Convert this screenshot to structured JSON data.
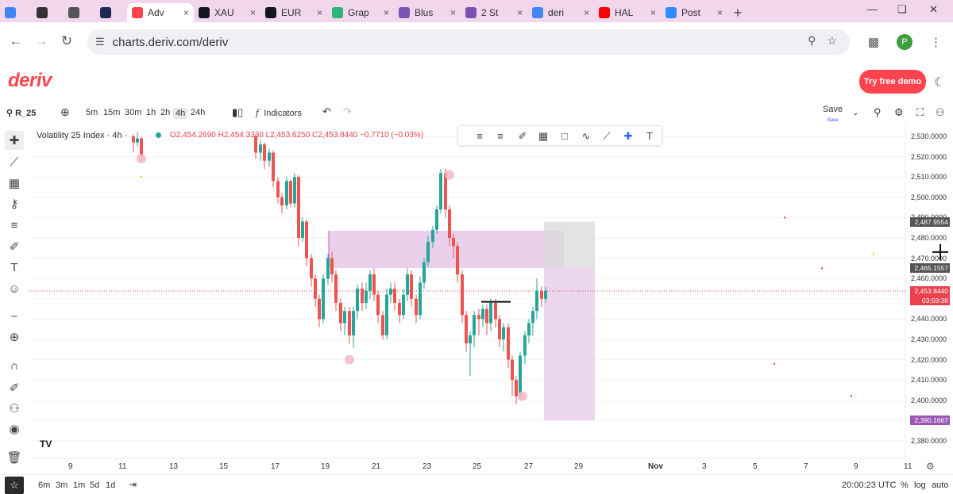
{
  "browser": {
    "tabs": [
      {
        "label": "",
        "icon": "docs-icon",
        "color": "#4285f4"
      },
      {
        "label": "",
        "icon": "chatgpt-icon",
        "color": "#333333"
      },
      {
        "label": "",
        "icon": "globe-icon",
        "color": "#555555"
      },
      {
        "label": "",
        "icon": "mountain-icon",
        "color": "#1b2a55"
      },
      {
        "label": "Adv",
        "icon": "deriv-icon",
        "color": "#ff444f"
      },
      {
        "label": "XAU",
        "icon": "tradingview-icon",
        "color": "#131722"
      },
      {
        "label": "EUR",
        "icon": "tradingview-icon",
        "color": "#131722"
      },
      {
        "label": "Grap",
        "icon": "graph-icon",
        "color": "#2bb673"
      },
      {
        "label": "Blus",
        "icon": "bootstrap-icon",
        "color": "#7952b3"
      },
      {
        "label": "2 St",
        "icon": "bootstrap-icon",
        "color": "#7952b3"
      },
      {
        "label": "deri",
        "icon": "google-icon",
        "color": "#4285f4"
      },
      {
        "label": "HAL",
        "icon": "youtube-icon",
        "color": "#ff0000"
      },
      {
        "label": "Post",
        "icon": "zoom-icon",
        "color": "#2d8cff"
      }
    ],
    "new_tab": "+",
    "url": "charts.deriv.com/deriv",
    "profile_initial": "P"
  },
  "deriv": {
    "logo": "deriv",
    "try_demo": "Try free demo"
  },
  "toolbar": {
    "symbol": "R_25",
    "timeframes": [
      "5m",
      "15m",
      "30m",
      "1h",
      "2h",
      "4h",
      "24h"
    ],
    "selected_timeframe": "4h",
    "indicators": "Indicators",
    "save": "Save",
    "save_sub": "Save"
  },
  "legend": {
    "title": "Volatility 25 Index · 4h ·",
    "ohlc": "O2,454.2690  H2,454.3330  L2,453.6250  C2,453.8440  −0.7710 (−0.03%)"
  },
  "price_scale": {
    "ticks": [
      "2,530.0000",
      "2,520.0000",
      "2,510.0000",
      "2,500.0000",
      "2,490.0000",
      "2,480.0000",
      "2,470.0000",
      "2,460.0000",
      "2,450.0000",
      "2,440.0000",
      "2,430.0000",
      "2,420.0000",
      "2,410.0000",
      "2,400.0000",
      "2,390.0000",
      "2,380.0000"
    ],
    "tags": [
      {
        "price": "2,487.9554",
        "color": "#555555"
      },
      {
        "price": "2,465.1557",
        "color": "#555555"
      },
      {
        "price": "2,453.8440",
        "color": "#e9414d",
        "countdown": "03:59:38"
      },
      {
        "price": "2,390.1667",
        "color": "#9c58b6"
      }
    ]
  },
  "time_scale": {
    "ticks": [
      "9",
      "11",
      "13",
      "15",
      "17",
      "19",
      "21",
      "23",
      "25",
      "27",
      "29",
      "Nov",
      "3",
      "5",
      "7",
      "9",
      "11"
    ]
  },
  "bottom": {
    "ranges": [
      "6m",
      "3m",
      "1m",
      "5d",
      "1d"
    ],
    "clock": "20:00:23 UTC",
    "percent": "%",
    "log": "log",
    "auto": "auto"
  },
  "chart_data": {
    "type": "candlestick",
    "symbol": "Volatility 25 Index",
    "interval": "4h",
    "last_price": 2453.844,
    "zones": [
      {
        "label": "supply-zone",
        "top": 2483.5,
        "bottom": 2465.1,
        "color": "#e6c8e8"
      },
      {
        "label": "target-zone",
        "top": 2465.1,
        "bottom": 2390.1667,
        "color": "#ead1ec"
      },
      {
        "label": "stop-zone",
        "top": 2487.9554,
        "bottom": 2465.1557,
        "color": "#d9d9d9"
      }
    ]
  }
}
